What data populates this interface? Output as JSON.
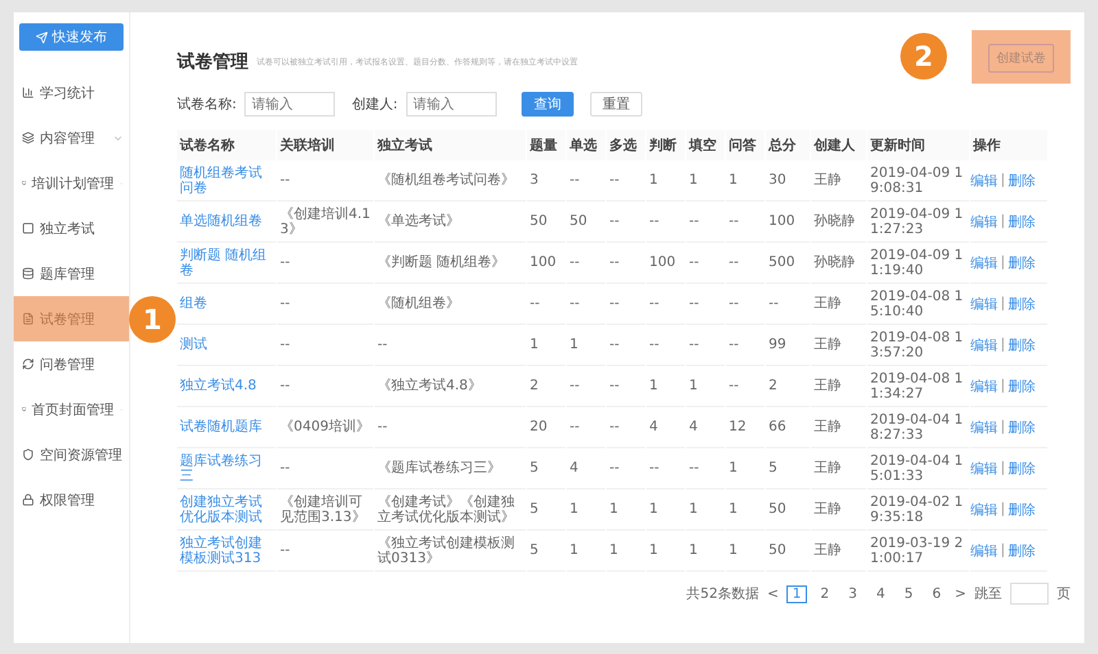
{
  "sidebar": {
    "publish_button": "快速发布",
    "items": [
      {
        "label": "学习统计",
        "selected": false,
        "expandable": false
      },
      {
        "label": "内容管理",
        "selected": false,
        "expandable": true
      },
      {
        "label": "培训计划管理",
        "selected": false,
        "expandable": true
      },
      {
        "label": "独立考试",
        "selected": false,
        "expandable": false
      },
      {
        "label": "题库管理",
        "selected": false,
        "expandable": false
      },
      {
        "label": "试卷管理",
        "selected": true,
        "expandable": false
      },
      {
        "label": "问卷管理",
        "selected": false,
        "expandable": false
      },
      {
        "label": "首页封面管理",
        "selected": false,
        "expandable": true
      },
      {
        "label": "空间资源管理",
        "selected": false,
        "expandable": false
      },
      {
        "label": "权限管理",
        "selected": false,
        "expandable": false
      }
    ]
  },
  "header": {
    "title": "试卷管理",
    "description": "试卷可以被独立考试引用，考试报名设置、题目分数、作答规则等，请在独立考试中设置",
    "create_button": "创建试卷"
  },
  "search": {
    "fields": [
      {
        "label": "试卷名称:",
        "placeholder": "请输入"
      },
      {
        "label": "创建人:",
        "placeholder": "请输入"
      }
    ],
    "buttons": [
      {
        "label": "查询",
        "kind": "primary"
      },
      {
        "label": "重置",
        "kind": "default"
      }
    ]
  },
  "table": {
    "columns": [
      "试卷名称",
      "关联培训",
      "独立考试",
      "题量",
      "单选",
      "多选",
      "判断",
      "填空",
      "问答",
      "总分",
      "创建人",
      "更新时间",
      "操作"
    ],
    "action_separator": "|",
    "rows": [
      {
        "cells": [
          "随机组卷考试问卷",
          "--",
          "《随机组卷考试问卷》",
          "3",
          "--",
          "--",
          "1",
          "1",
          "1",
          "30",
          "王静",
          "2019-04-09 19:08:31"
        ],
        "actions": [
          "编辑",
          "删除"
        ]
      },
      {
        "cells": [
          "单选随机组卷",
          "《创建培训4.13》",
          "《单选考试》",
          "50",
          "50",
          "--",
          "--",
          "--",
          "--",
          "100",
          "孙晓静",
          "2019-04-09 11:27:23"
        ],
        "actions": [
          "编辑",
          "删除"
        ]
      },
      {
        "cells": [
          "判断题 随机组卷",
          "--",
          "《判断题 随机组卷》",
          "100",
          "--",
          "--",
          "100",
          "--",
          "--",
          "500",
          "孙晓静",
          "2019-04-09 11:19:40"
        ],
        "actions": [
          "编辑",
          "删除"
        ]
      },
      {
        "cells": [
          "组卷",
          "--",
          "《随机组卷》",
          "--",
          "--",
          "--",
          "--",
          "--",
          "--",
          "--",
          "王静",
          "2019-04-08 15:10:40"
        ],
        "actions": [
          "编辑",
          "删除"
        ]
      },
      {
        "cells": [
          "测试",
          "--",
          "--",
          "1",
          "1",
          "--",
          "--",
          "--",
          "--",
          "99",
          "王静",
          "2019-04-08 13:57:20"
        ],
        "actions": [
          "编辑",
          "删除"
        ]
      },
      {
        "cells": [
          "独立考试4.8",
          "--",
          "《独立考试4.8》",
          "2",
          "--",
          "--",
          "1",
          "1",
          "--",
          "2",
          "王静",
          "2019-04-08 11:34:27"
        ],
        "actions": [
          "编辑",
          "删除"
        ]
      },
      {
        "cells": [
          "试卷随机题库",
          "《0409培训》",
          "--",
          "20",
          "--",
          "--",
          "4",
          "4",
          "12",
          "66",
          "王静",
          "2019-04-04 18:27:33"
        ],
        "actions": [
          "编辑",
          "删除"
        ]
      },
      {
        "cells": [
          "题库试卷练习三",
          "--",
          "《题库试卷练习三》",
          "5",
          "4",
          "--",
          "--",
          "--",
          "1",
          "5",
          "王静",
          "2019-04-04 15:01:33"
        ],
        "actions": [
          "编辑",
          "删除"
        ]
      },
      {
        "cells": [
          "创建独立考试优化版本测试",
          "《创建培训可见范围3.13》",
          "《创建考试》《创建独立考试优化版本测试》",
          "5",
          "1",
          "1",
          "1",
          "1",
          "1",
          "50",
          "王静",
          "2019-04-02 19:35:18"
        ],
        "actions": [
          "编辑",
          "删除"
        ]
      },
      {
        "cells": [
          "独立考试创建模板测试313",
          "--",
          "《独立考试创建模板测试0313》",
          "5",
          "1",
          "1",
          "1",
          "1",
          "1",
          "50",
          "王静",
          "2019-03-19 21:00:17"
        ],
        "actions": [
          "编辑",
          "删除"
        ]
      }
    ]
  },
  "pagination": {
    "total": "共52条数据",
    "prev": "<",
    "next": ">",
    "pages": [
      {
        "label": "1",
        "selected": true
      },
      {
        "label": "2",
        "selected": false
      },
      {
        "label": "3",
        "selected": false
      },
      {
        "label": "4",
        "selected": false
      },
      {
        "label": "5",
        "selected": false
      },
      {
        "label": "6",
        "selected": false
      }
    ],
    "jump_label": "跳至",
    "page_suffix": "页"
  },
  "annotations": [
    {
      "label": "1"
    },
    {
      "label": "2"
    }
  ]
}
